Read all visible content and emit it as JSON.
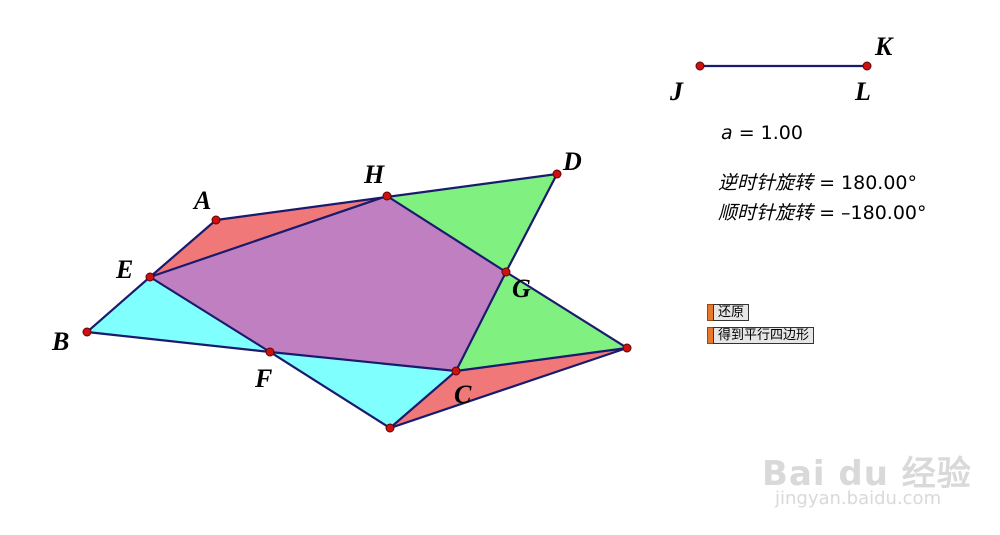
{
  "points": {
    "A": "A",
    "B": "B",
    "C": "C",
    "D": "D",
    "E": "E",
    "F": "F",
    "G": "G",
    "H": "H",
    "J": "J",
    "K": "K",
    "L": "L"
  },
  "measurements": {
    "a_var": "a",
    "a_value": "= 1.00",
    "ccw_label": "逆时针旋转",
    "ccw_value": "= 180.00°",
    "cw_label": "顺时针旋转",
    "cw_value": "= –180.00°"
  },
  "buttons": {
    "restore": "还原",
    "parallelogram": "得到平行四边形"
  },
  "colors": {
    "red_triangle": "#f07878",
    "green_triangle": "#80f080",
    "cyan_triangle": "#80ffff",
    "center_quad": "#c07fc0",
    "edge": "#1a1a6e",
    "point": "#cc1111"
  },
  "watermark": {
    "brand": "Bai du 经验",
    "url": "jingyan.baidu.com"
  }
}
